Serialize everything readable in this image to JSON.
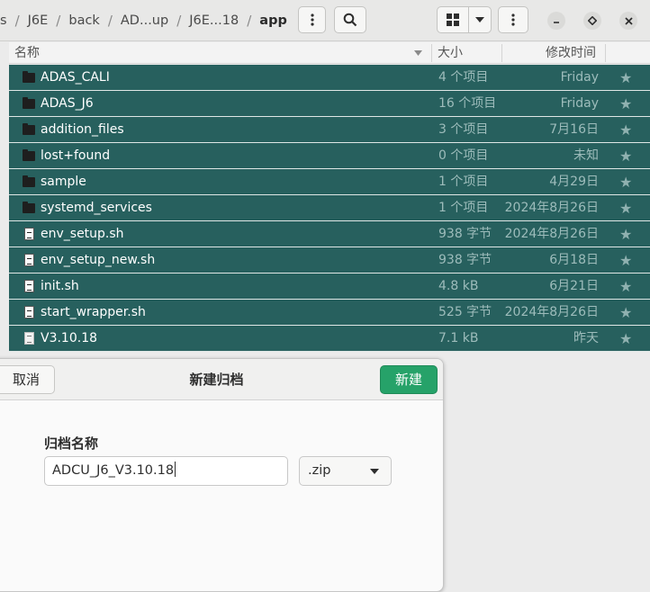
{
  "breadcrumbs": [
    "s",
    "J6E",
    "back",
    "AD...up",
    "J6E...18",
    "app"
  ],
  "toolbar": {
    "path_menu_icon": "vertical-dots-icon",
    "search_icon": "search-icon",
    "view_icon": "grid-view-icon",
    "view_dropdown_icon": "chevron-down-icon",
    "main_menu_icon": "vertical-dots-icon",
    "minimize_icon": "minimize-icon",
    "restore_icon": "restore-icon",
    "close_icon": "close-icon"
  },
  "columns": {
    "name": "名称",
    "size": "大小",
    "modified": "修改时间"
  },
  "files": [
    {
      "name": "ADAS_CALI",
      "size": "4 个项目",
      "modified": "Friday",
      "type": "folder"
    },
    {
      "name": "ADAS_J6",
      "size": "16 个项目",
      "modified": "Friday",
      "type": "folder"
    },
    {
      "name": "addition_files",
      "size": "3 个项目",
      "modified": "7月16日",
      "type": "folder"
    },
    {
      "name": "lost+found",
      "size": "0 个项目",
      "modified": "未知",
      "type": "folder"
    },
    {
      "name": "sample",
      "size": "1 个项目",
      "modified": "4月29日",
      "type": "folder"
    },
    {
      "name": "systemd_services",
      "size": "1 个项目",
      "modified": "2024年8月26日",
      "type": "folder"
    },
    {
      "name": "env_setup.sh",
      "size": "938 字节",
      "modified": "2024年8月26日",
      "type": "script"
    },
    {
      "name": "env_setup_new.sh",
      "size": "938 字节",
      "modified": "6月18日",
      "type": "script"
    },
    {
      "name": "init.sh",
      "size": "4.8 kB",
      "modified": "6月21日",
      "type": "script"
    },
    {
      "name": "start_wrapper.sh",
      "size": "525 字节",
      "modified": "2024年8月26日",
      "type": "script"
    },
    {
      "name": "V3.10.18",
      "size": "7.1 kB",
      "modified": "昨天",
      "type": "document"
    }
  ],
  "dialog": {
    "title": "新建归档",
    "cancel_label": "取消",
    "create_label": "新建",
    "field_label": "归档名称",
    "archive_name": "ADCU_J6_V3.10.18",
    "extension": ".zip"
  },
  "colors": {
    "selection": "#27605e",
    "create_button": "#26a269"
  }
}
